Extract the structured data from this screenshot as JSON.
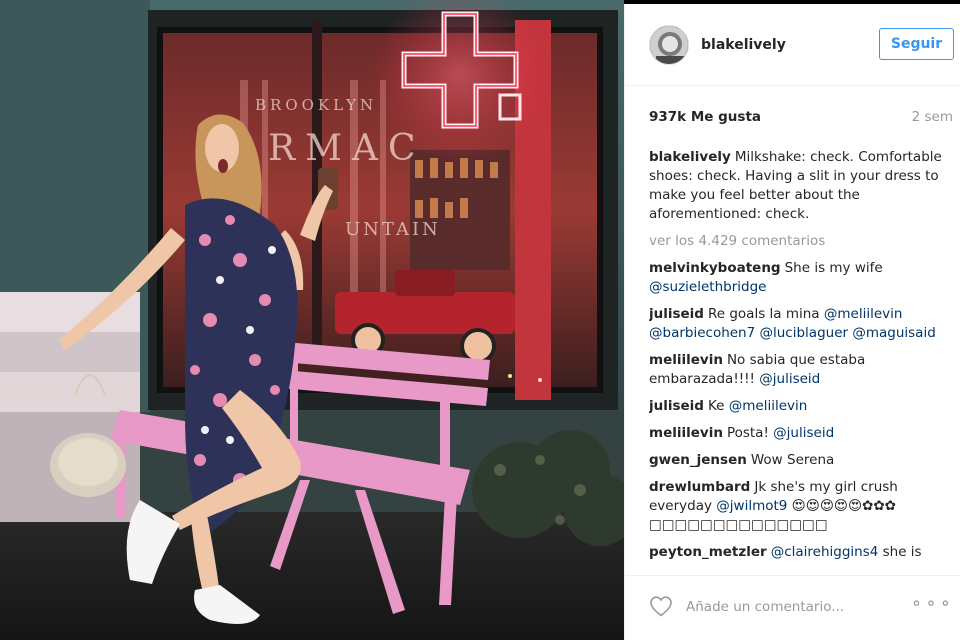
{
  "header": {
    "username": "blakelively",
    "follow_label": "Seguir"
  },
  "stats": {
    "likes": "937k Me gusta",
    "ago": "2 sem"
  },
  "caption": {
    "user": "blakelively",
    "text": "Milkshake: check. Comfortable shoes: check. Having a slit in your dress to make you feel better about the aforementioned: check."
  },
  "view_more": "ver los 4.429 comentarios",
  "comments": [
    {
      "user": "melvinkyboateng",
      "text": "She is my wife",
      "mention": "@suzielethbridge"
    },
    {
      "user": "juliseid",
      "text": "Re goals la mina",
      "mention": "@meliilevin @barbiecohen7 @luciblaguer @maguisaid"
    },
    {
      "user": "meliilevin",
      "text": "No sabia que estaba embarazada!!!!",
      "mention": "@juliseid"
    },
    {
      "user": "juliseid",
      "text": "Ke",
      "mention": "@meliilevin"
    },
    {
      "user": "meliilevin",
      "text": "Posta!",
      "mention": "@juliseid"
    },
    {
      "user": "gwen_jensen",
      "text": "Wow Serena",
      "mention": ""
    },
    {
      "user": "drewlumbard",
      "text": "Jk she's my girl crush everyday",
      "mention": "@jwilmot9",
      "tail": "😍😍😍😍😍✿✿✿ □□□□□□□□□□□□□□"
    },
    {
      "user": "peyton_metzler",
      "text": "",
      "mention": "@clairehiggins4",
      "tail": "she is"
    }
  ],
  "footer": {
    "add_comment_placeholder": "Añade un comentario...",
    "options_label": "⚬⚬⚬"
  },
  "photo": {
    "sign_text": "BROOKLYN FARMACY SODA FOUNTAIN",
    "sign_lines": [
      "BROOKLYN",
      "RMAC",
      "UNTAIN"
    ]
  },
  "colors": {
    "accent": "#3897f0",
    "mention": "#003569",
    "neon": "#ff2d4d",
    "bench": "#e899c8"
  }
}
